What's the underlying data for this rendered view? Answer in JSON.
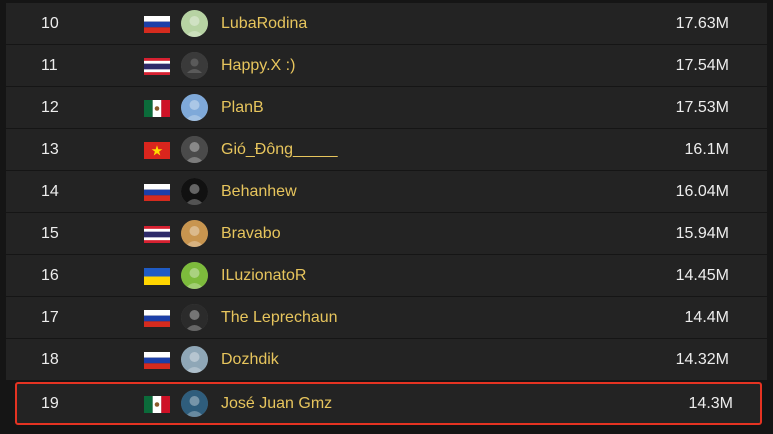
{
  "leaderboard": {
    "rows": [
      {
        "rank": "10",
        "country": "RU",
        "name": "LubaRodina",
        "score": "17.63M",
        "avatar": "avatar-photo-icon",
        "avatar_color": "#b7d3a3"
      },
      {
        "rank": "11",
        "country": "TH",
        "name": "Happy.X :)",
        "score": "17.54M",
        "avatar": "default-user-icon",
        "avatar_color": "#3a3a3a"
      },
      {
        "rank": "12",
        "country": "MX",
        "name": "PlanB",
        "score": "17.53M",
        "avatar": "avatar-photo-icon",
        "avatar_color": "#7fa9d9"
      },
      {
        "rank": "13",
        "country": "VN",
        "name": "Gió_Đông_____",
        "score": "16.1M",
        "avatar": "avatar-photo-icon",
        "avatar_color": "#4a4a4a"
      },
      {
        "rank": "14",
        "country": "RU",
        "name": "Behanhew",
        "score": "16.04M",
        "avatar": "avatar-photo-icon",
        "avatar_color": "#111111"
      },
      {
        "rank": "15",
        "country": "TH",
        "name": "Bravabo",
        "score": "15.94M",
        "avatar": "avatar-photo-icon",
        "avatar_color": "#c8954f"
      },
      {
        "rank": "16",
        "country": "UA",
        "name": "ILuzionatoR",
        "score": "14.45M",
        "avatar": "avatar-photo-icon",
        "avatar_color": "#7dbb3c"
      },
      {
        "rank": "17",
        "country": "RU",
        "name": "The Leprechaun",
        "score": "14.4M",
        "avatar": "avatar-photo-icon",
        "avatar_color": "#2b2b2b"
      },
      {
        "rank": "18",
        "country": "RU",
        "name": "Dozhdik",
        "score": "14.32M",
        "avatar": "avatar-photo-icon",
        "avatar_color": "#8fa7b7"
      }
    ],
    "highlighted": {
      "rank": "19",
      "country": "MX",
      "name": "José Juan Gmz",
      "score": "14.3M",
      "avatar": "avatar-photo-icon",
      "avatar_color": "#2f5d7c"
    },
    "colors": {
      "name": "#e7c55d",
      "rank_score": "#ededed",
      "row_bg": "#232323",
      "page_bg": "#151515",
      "highlight_border": "#e53322"
    }
  }
}
